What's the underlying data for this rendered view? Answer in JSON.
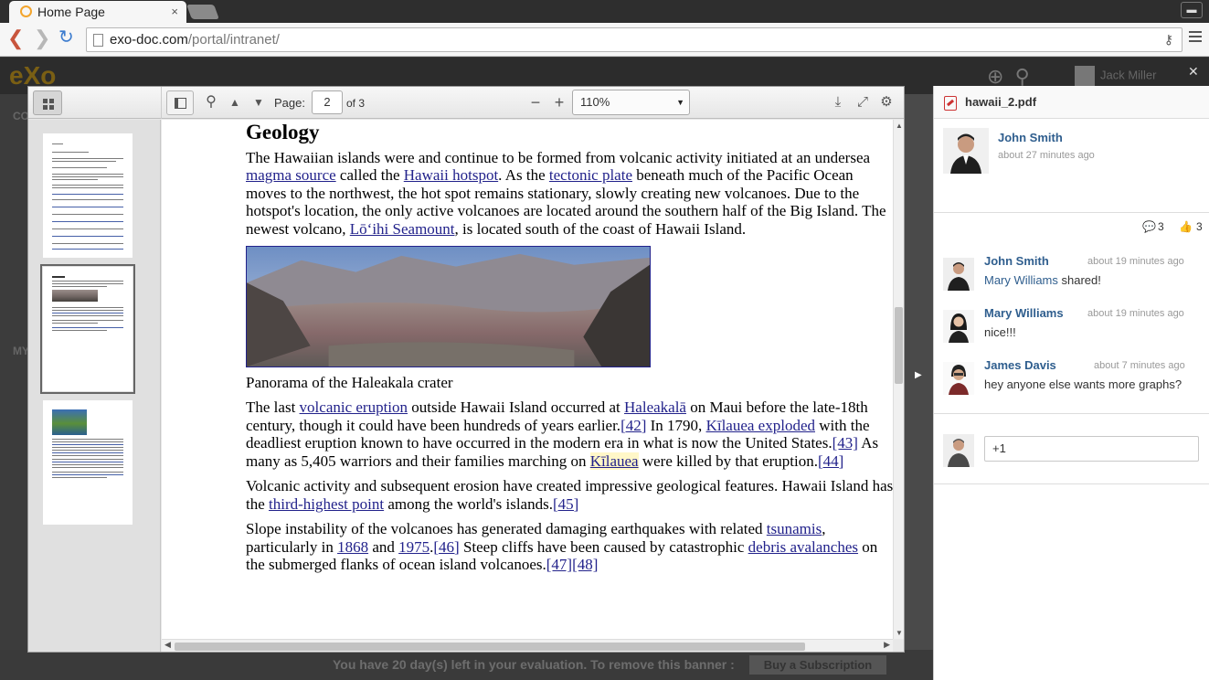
{
  "browser": {
    "tab_title": "Home Page",
    "tab_close": "×",
    "url_host": "exo-doc.com",
    "url_path": "/portal/intranet/"
  },
  "portal": {
    "logo": "eXo",
    "user_name": "Jack Miller",
    "left_labels": [
      "CO",
      "MY"
    ],
    "banner_text": "You have 20 day(s) left in your evaluation. To remove this banner :",
    "banner_button": "Buy a Subscription"
  },
  "viewer": {
    "page_label": "Page:",
    "page_number": "2",
    "page_count": "of 3",
    "zoom": "110%",
    "doc": {
      "heading": "Geology",
      "p1": {
        "t1": "The Hawaiian islands were and continue to be formed from volcanic activity initiated at an undersea ",
        "l1": "magma source",
        "t2": " called the ",
        "l2": "Hawaii hotspot",
        "t3": ". As the ",
        "l3": "tectonic plate",
        "t4": " beneath much of the Pacific Ocean moves to the northwest, the hot spot remains stationary, slowly creating new volcanoes. Due to the hotspot's location, the only active volcanoes are located around the southern half of the Big Island. The newest volcano, ",
        "l4": "Lōʻihi Seamount",
        "t5": ", is located south of the coast of Hawaii Island."
      },
      "caption": "Panorama of the Haleakala crater",
      "p2": {
        "t1": "The last ",
        "l1": "volcanic eruption",
        "t2": " outside Hawaii Island occurred at ",
        "l2": "Haleakalā",
        "t3": " on Maui before the late-18th century, though it could have been hundreds of years earlier.",
        "l3": "[42]",
        "t4": " In 1790, ",
        "l4": "Kīlauea exploded",
        "t5": " with the deadliest eruption known to have occurred in the modern era in what is now the United States.",
        "l5": "[43]",
        "t6": " As many as 5,405 warriors and their families marching on ",
        "l6": "Kīlauea",
        "t7": " were killed by that eruption.",
        "l7": "[44]"
      },
      "p3": {
        "t1": "Volcanic activity and subsequent erosion have created impressive geological features. Hawaii Island has the ",
        "l1": "third-highest point",
        "t2": " among the world's islands.",
        "l2": "[45]"
      },
      "p4": {
        "t1": "Slope instability of the volcanoes has generated damaging earthquakes with related ",
        "l1": "tsunamis",
        "t2": ", particularly in ",
        "l2": "1868",
        "t3": " and ",
        "l3": "1975",
        "t4": ".",
        "l4": "[46]",
        "t5": " Steep cliffs have been caused by catastrophic ",
        "l5": "debris avalanches",
        "t6": " on the submerged flanks of ocean island volcanoes.",
        "l6": "[47]",
        "l7": "[48]"
      }
    }
  },
  "panel": {
    "file_name": "hawaii_2.pdf",
    "author": "John Smith",
    "author_time": "about 27 minutes ago",
    "comment_count": "3",
    "like_count": "3",
    "comments": [
      {
        "user": "John Smith",
        "time": "about 19 minutes ago",
        "mention": "Mary Williams",
        "text": " shared!"
      },
      {
        "user": "Mary Williams",
        "time": "about 19 minutes ago",
        "text": "nice!!!"
      },
      {
        "user": "James Davis",
        "time": "about 7 minutes ago",
        "text": "hey anyone else wants more graphs?"
      }
    ],
    "reply_value": "+1"
  }
}
